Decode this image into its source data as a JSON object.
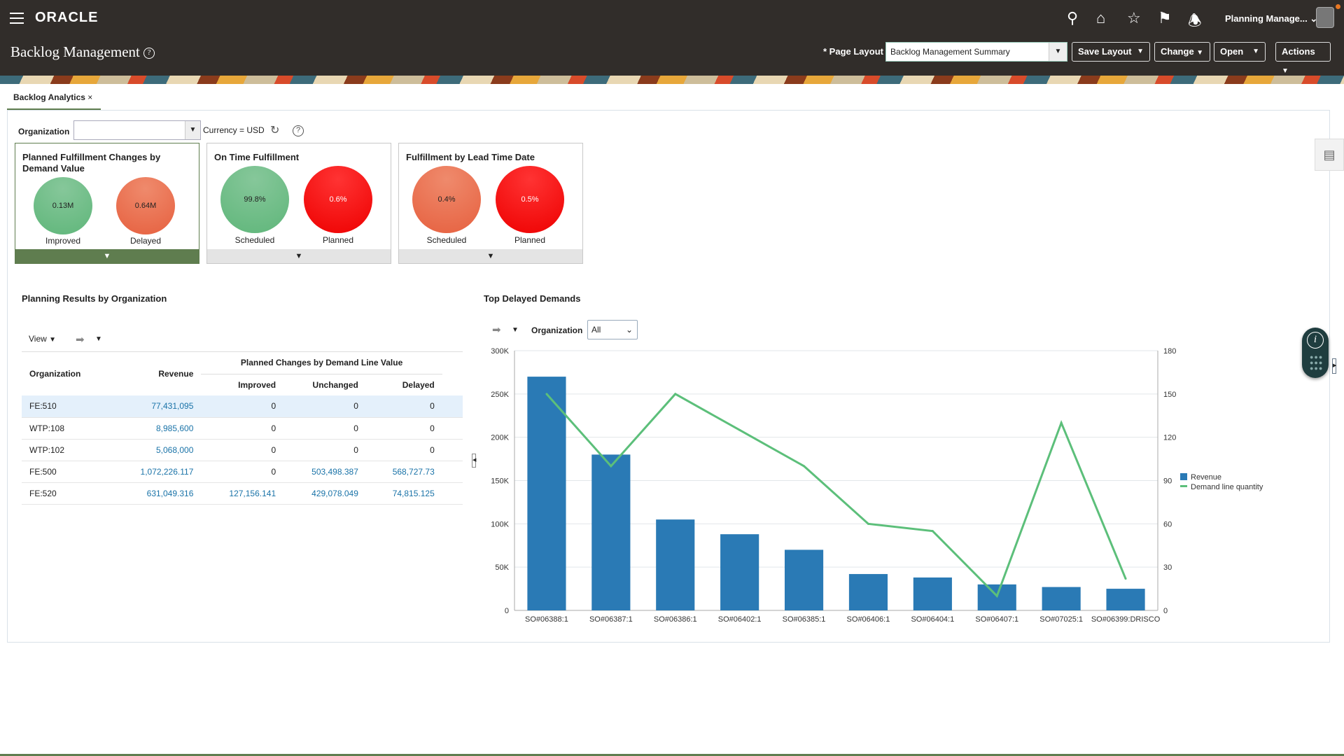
{
  "header": {
    "logo": "ORACLE",
    "title": "Backlog Management",
    "user": "Planning Manage...",
    "icons": [
      "search-icon",
      "home-icon",
      "star-icon",
      "flag-icon",
      "bell-icon"
    ]
  },
  "toolbar": {
    "page_layout_label": "* Page Layout",
    "page_layout_value": "Backlog Management Summary",
    "save_layout": "Save Layout",
    "change": "Change",
    "open": "Open",
    "actions": "Actions"
  },
  "tab": {
    "label": "Backlog Analytics",
    "close": "×"
  },
  "filters": {
    "organization_label": "Organization",
    "organization_value": "",
    "currency": "Currency = USD"
  },
  "cards": [
    {
      "title": "Planned Fulfillment Changes by Demand Value",
      "items": [
        {
          "value": "0.13M",
          "label": "Improved",
          "color": "#5fb67a"
        },
        {
          "value": "0.64M",
          "label": "Delayed",
          "color": "#e6603f"
        }
      ]
    },
    {
      "title": "On Time Fulfillment",
      "items": [
        {
          "value": "99.8%",
          "label": "Scheduled",
          "color": "#5fb67a"
        },
        {
          "value": "0.6%",
          "label": "Planned",
          "color": "#e80c0c"
        }
      ]
    },
    {
      "title": "Fulfillment by Lead Time Date",
      "items": [
        {
          "value": "0.4%",
          "label": "Scheduled",
          "color": "#e6603f"
        },
        {
          "value": "0.5%",
          "label": "Planned",
          "color": "#e80c0c"
        }
      ]
    }
  ],
  "planning": {
    "title": "Planning Results by Organization",
    "view": "View",
    "columns": {
      "organization": "Organization",
      "revenue": "Revenue",
      "group": "Planned Changes by Demand Line Value",
      "improved": "Improved",
      "unchanged": "Unchanged",
      "delayed": "Delayed"
    },
    "rows": [
      [
        "FE:510",
        "77,431,095",
        "0",
        "0",
        "0"
      ],
      [
        "WTP:108",
        "8,985,600",
        "0",
        "0",
        "0"
      ],
      [
        "WTP:102",
        "5,068,000",
        "0",
        "0",
        "0"
      ],
      [
        "FE:500",
        "1,072,226.117",
        "0",
        "503,498.387",
        "568,727.73"
      ],
      [
        "FE:520",
        "631,049.316",
        "127,156.141",
        "429,078.049",
        "74,815.125"
      ]
    ]
  },
  "delayed": {
    "title": "Top Delayed Demands",
    "org_label": "Organization",
    "org_value": "All"
  },
  "chart_data": {
    "type": "bar+line",
    "categories": [
      "SO#06388:1",
      "SO#06387:1",
      "SO#06386:1",
      "SO#06402:1",
      "SO#06385:1",
      "SO#06406:1",
      "SO#06404:1",
      "SO#06407:1",
      "SO#07025:1",
      "SO#06399:DRISCO"
    ],
    "series": [
      {
        "name": "Revenue",
        "type": "bar",
        "axis": "left",
        "color": "#2a7ab5",
        "values": [
          270000,
          180000,
          105000,
          88000,
          70000,
          42000,
          38000,
          30000,
          27000,
          25000
        ]
      },
      {
        "name": "Demand line quantity",
        "type": "line",
        "axis": "right",
        "color": "#5cbf7a",
        "values": [
          150,
          100,
          150,
          125,
          100,
          60,
          55,
          10,
          130,
          22
        ]
      }
    ],
    "y_left": {
      "range": [
        0,
        300000
      ],
      "ticks": [
        "0",
        "50K",
        "100K",
        "150K",
        "200K",
        "250K",
        "300K"
      ]
    },
    "y_right": {
      "range": [
        0,
        180
      ],
      "ticks": [
        "0",
        "30",
        "60",
        "90",
        "120",
        "150",
        "180"
      ]
    },
    "grid": true,
    "legend": "right"
  }
}
